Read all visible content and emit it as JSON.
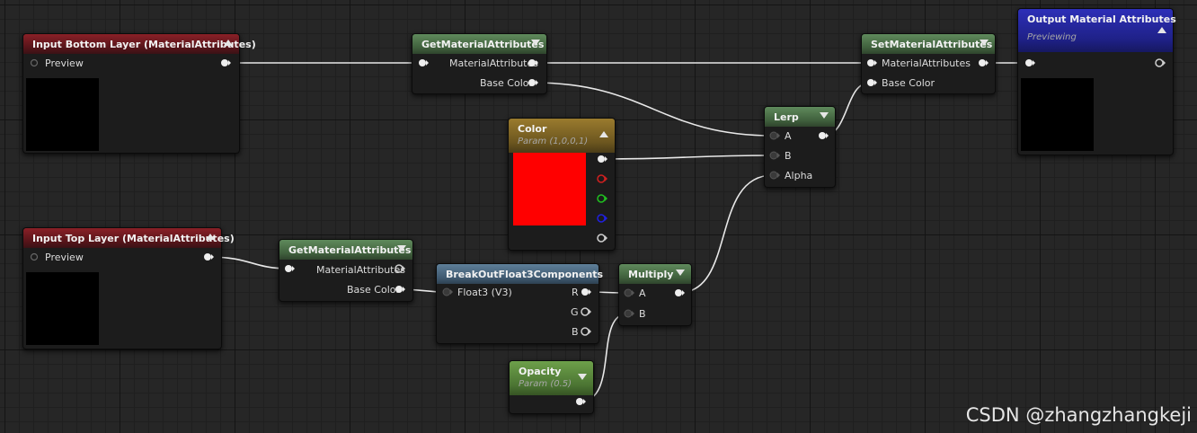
{
  "nodes": {
    "input_bottom": {
      "title": "Input Bottom Layer (MaterialAttributes)",
      "pin": "Preview"
    },
    "input_top": {
      "title": "Input Top Layer (MaterialAttributes)",
      "pin": "Preview"
    },
    "get_top": {
      "title": "GetMaterialAttributes",
      "pins": [
        "MaterialAttributes",
        "Base Color"
      ]
    },
    "get_bottom": {
      "title": "GetMaterialAttributes",
      "pins": [
        "MaterialAttributes",
        "Base Color"
      ]
    },
    "color": {
      "title": "Color",
      "subtitle": "Param (1,0,0,1)"
    },
    "lerp": {
      "title": "Lerp",
      "pins": [
        "A",
        "B",
        "Alpha"
      ]
    },
    "set": {
      "title": "SetMaterialAttributes",
      "pins": [
        "MaterialAttributes",
        "Base Color"
      ]
    },
    "output": {
      "title": "Output Material Attributes",
      "subtitle": "Previewing"
    },
    "breakout": {
      "title": "BreakOutFloat3Components",
      "input": "Float3 (V3)",
      "outputs": [
        "R",
        "G",
        "B"
      ]
    },
    "multiply": {
      "title": "Multiply",
      "pins": [
        "A",
        "B"
      ]
    },
    "opacity": {
      "title": "Opacity",
      "subtitle": "Param (0.5)"
    }
  },
  "colors": {
    "param_color": "#ff0000",
    "pin_r": "#d02020",
    "pin_g": "#20c020",
    "pin_b": "#2020e0",
    "wire": "#e8e8e8"
  },
  "watermark": "CSDN @zhangzhangkeji"
}
